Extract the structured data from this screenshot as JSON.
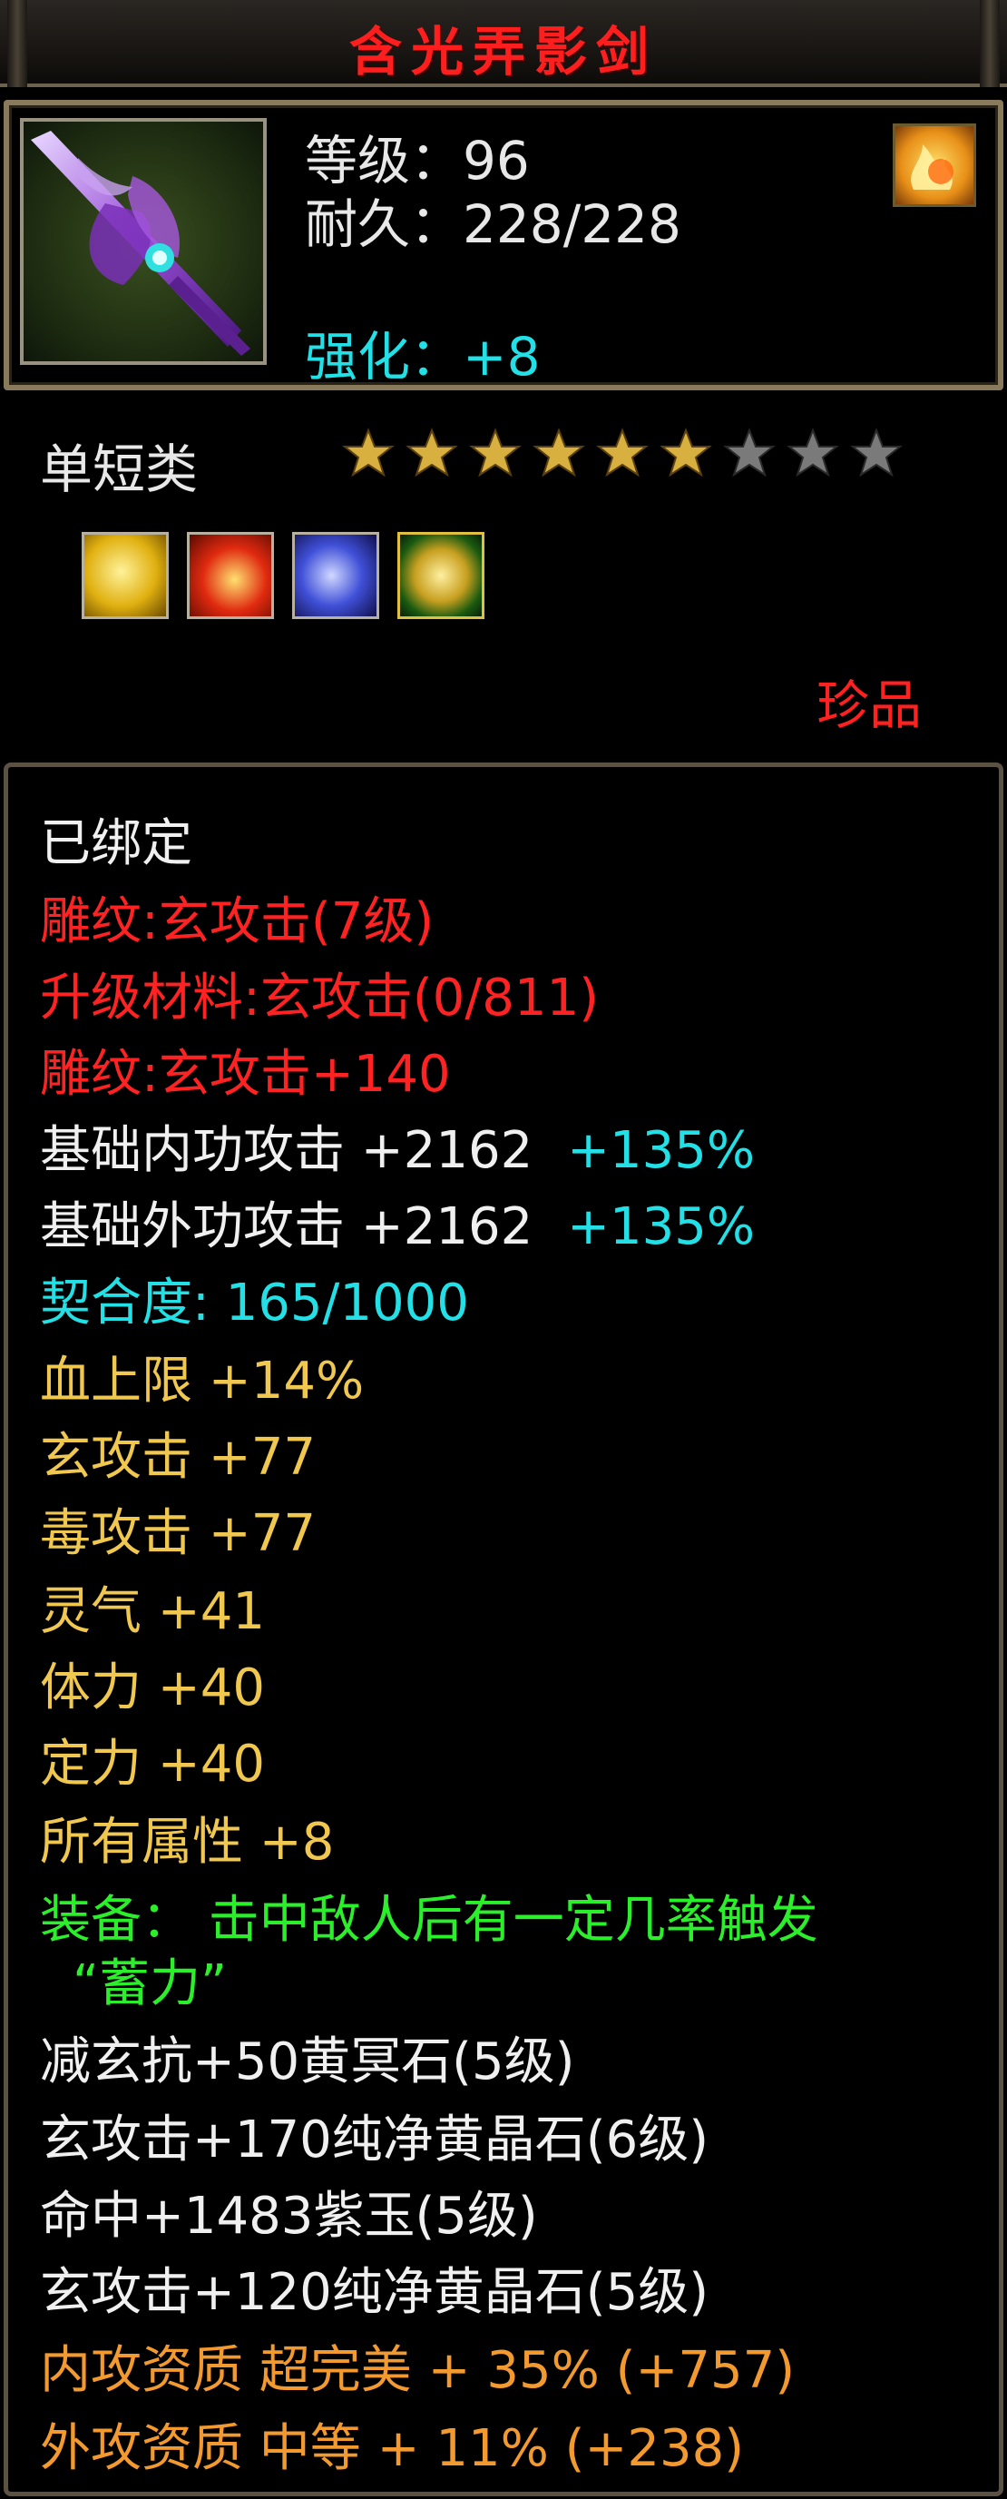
{
  "item": {
    "name": "含光弄影剑",
    "level_line": "等级：96",
    "durability_line": "耐久：228/228",
    "enhance_line": "强化：+8",
    "class_label": "单短类",
    "stars_filled": 6,
    "stars_total": 9,
    "rarity": "珍品"
  },
  "gems": [
    {
      "name": "gold-crystal-gem-icon",
      "color": "#e8c020"
    },
    {
      "name": "red-fire-gem-icon",
      "color": "#d83018"
    },
    {
      "name": "blue-purple-gem-icon",
      "color": "#4050d8"
    },
    {
      "name": "green-gold-gem-icon",
      "color": "#c8a020"
    }
  ],
  "attributes": {
    "bound": "已绑定",
    "engrave": "雕纹:玄攻击(7级)",
    "upgrade_material": "升级材料:玄攻击(0/811)",
    "engrave_bonus": "雕纹:玄攻击+140",
    "base_inner_label": "基础内功攻击 +2162",
    "base_inner_pct": "+135%",
    "base_outer_label": "基础外功攻击 +2162",
    "base_outer_pct": "+135%",
    "affinity": "契合度: 165/1000",
    "stats": [
      "血上限 +14%",
      "玄攻击 +77",
      "毒攻击 +77",
      "灵气 +41",
      "体力 +40",
      "定力 +40",
      "所有属性 +8"
    ],
    "equip_effect_1": "装备： 击中敌人后有一定几率触发",
    "equip_effect_2": "“蓄力”",
    "gem_lines": [
      "减玄抗+50黄冥石(5级)",
      "玄攻击+170纯净黄晶石(6级)",
      "命中+1483紫玉(5级)",
      "玄攻击+120纯净黄晶石(5级)"
    ],
    "inner_quality": "内攻资质 超完美 + 35% (+757)",
    "outer_quality": "外攻资质 中等 + 11% (+238)"
  },
  "colors": {
    "title": "#ff1e1e",
    "cyan": "#22e0e6",
    "red": "#ff2222",
    "gold": "#f0c850",
    "green": "#2cef2c",
    "orange": "#f29a30"
  }
}
